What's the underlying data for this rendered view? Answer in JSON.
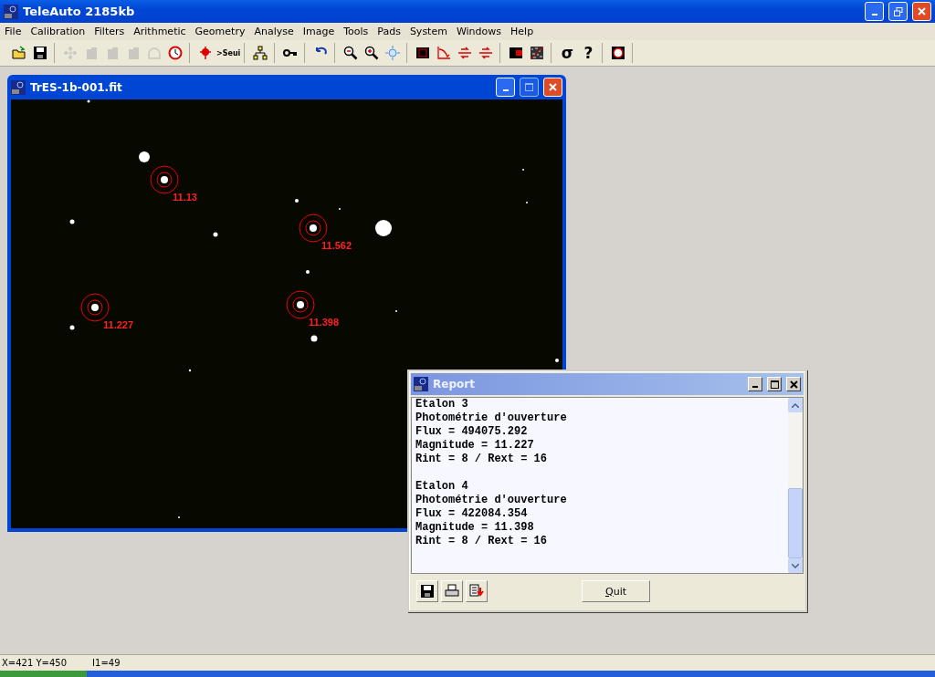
{
  "window": {
    "title": "TeleAuto 2185kb"
  },
  "menu": [
    "File",
    "Calibration",
    "Filters",
    "Arithmetic",
    "Geometry",
    "Analyse",
    "Image",
    "Tools",
    "Pads",
    "System",
    "Windows",
    "Help"
  ],
  "toolbar": [
    [
      {
        "kind": "open",
        "disabled": false
      },
      {
        "kind": "save",
        "disabled": false
      }
    ],
    [
      {
        "kind": "move",
        "disabled": true
      },
      {
        "kind": "shape",
        "disabled": true
      },
      {
        "kind": "shape",
        "disabled": true
      },
      {
        "kind": "shape",
        "disabled": true
      },
      {
        "kind": "dome",
        "disabled": true
      },
      {
        "kind": "clock",
        "disabled": false
      }
    ],
    [
      {
        "kind": "bug",
        "disabled": false
      },
      {
        "kind": "glyph",
        "glyph": ">Seui",
        "disabled": false
      }
    ],
    [
      {
        "kind": "network",
        "disabled": false
      }
    ],
    [
      {
        "kind": "key",
        "disabled": false
      }
    ],
    [
      {
        "kind": "undo",
        "disabled": false
      }
    ],
    [
      {
        "kind": "zoom-out",
        "disabled": false
      },
      {
        "kind": "zoom-in",
        "disabled": false
      },
      {
        "kind": "sun",
        "disabled": false
      }
    ],
    [
      {
        "kind": "film",
        "disabled": false
      },
      {
        "kind": "curve",
        "disabled": false
      },
      {
        "kind": "arrows",
        "disabled": false
      },
      {
        "kind": "arrows",
        "disabled": false
      }
    ],
    [
      {
        "kind": "half",
        "disabled": false
      },
      {
        "kind": "noise",
        "disabled": false
      }
    ],
    [
      {
        "kind": "glyph",
        "glyph": "σ",
        "disabled": false
      },
      {
        "kind": "glyph",
        "glyph": "?",
        "disabled": false
      }
    ],
    [
      {
        "kind": "ring",
        "disabled": false
      }
    ]
  ],
  "image_window": {
    "title": "TrES-1b-001.fit",
    "annotations": [
      "11.13",
      "11.562",
      "11.227",
      "11.398"
    ]
  },
  "report": {
    "title": "Report",
    "blocks": [
      [
        "Etalon 3",
        "Photométrie d'ouverture",
        "Flux = 494075.292",
        "Magnitude = 11.227",
        "Rint = 8 / Rext = 16"
      ],
      [
        "Etalon 4",
        "Photométrie d'ouverture",
        "Flux = 422084.354",
        "Magnitude = 11.398",
        "Rint = 8 / Rext = 16"
      ]
    ],
    "button": "Quit"
  },
  "status_bar": [
    "X=421 Y=450",
    "I1=49"
  ]
}
